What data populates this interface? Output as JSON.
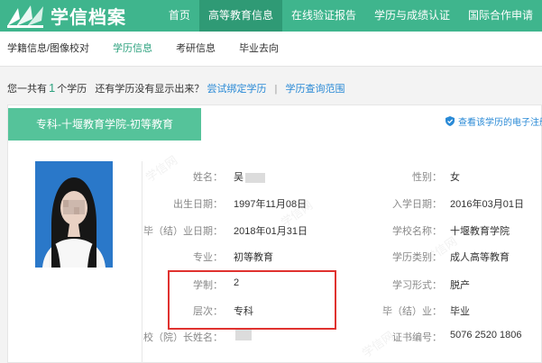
{
  "logo": {
    "text": "学信档案"
  },
  "nav": [
    {
      "label": "首页",
      "active": false
    },
    {
      "label": "高等教育信息",
      "active": true
    },
    {
      "label": "在线验证报告",
      "active": false
    },
    {
      "label": "学历与成绩认证",
      "active": false
    },
    {
      "label": "国际合作申请",
      "active": false
    }
  ],
  "subnav": [
    {
      "label": "学籍信息/图像校对",
      "active": false
    },
    {
      "label": "学历信息",
      "active": true
    },
    {
      "label": "考研信息",
      "active": false
    },
    {
      "label": "毕业去向",
      "active": false
    }
  ],
  "summary": {
    "prefix": "您一共有",
    "count": "1",
    "suffix": "个学历",
    "question": "还有学历没有显示出来？",
    "bind_link": "尝试绑定学历",
    "separator": "|",
    "scope_link": "学历查询范围"
  },
  "card": {
    "tab_label": "专科-十堰教育学院-初等教育",
    "verify_link": "查看该学历的电子注册",
    "fields_left": [
      {
        "label": "姓名：",
        "value": "吴",
        "redacted": true
      },
      {
        "label": "出生日期：",
        "value": "1997年11月08日"
      },
      {
        "label": "毕（结）业日期：",
        "value": "2018年01月31日"
      },
      {
        "label": "专业：",
        "value": "初等教育"
      },
      {
        "label": "学制：",
        "value": "2"
      },
      {
        "label": "层次：",
        "value": "专科"
      },
      {
        "label": "校（院）长姓名：",
        "value": "",
        "redacted": true
      }
    ],
    "fields_right": [
      {
        "label": "性别：",
        "value": "女"
      },
      {
        "label": "入学日期：",
        "value": "2016年03月01日"
      },
      {
        "label": "学校名称：",
        "value": "十堰教育学院"
      },
      {
        "label": "学历类别：",
        "value": "成人高等教育"
      },
      {
        "label": "学习形式：",
        "value": "脱产"
      },
      {
        "label": "毕（结）业：",
        "value": "毕业"
      },
      {
        "label": "证书编号：",
        "value": "5076 2520 1806"
      }
    ]
  },
  "colors": {
    "brand": "#3fb58d",
    "tab": "#55c39a",
    "link": "#2a8ad6",
    "highlight": "#e0322f"
  },
  "icons": {
    "verify": "shield-check-icon",
    "logo": "book-logo-icon"
  }
}
